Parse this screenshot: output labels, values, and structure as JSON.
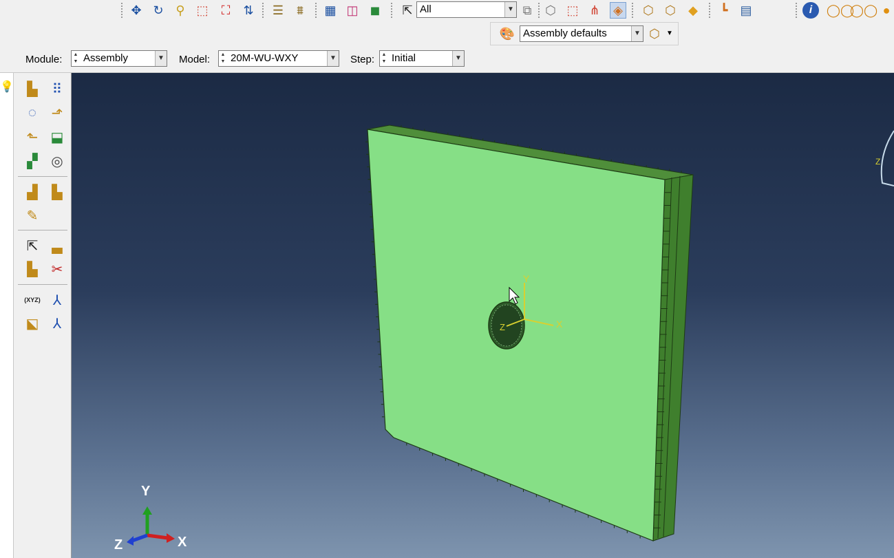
{
  "toolbar": {
    "selection_filter": "All",
    "display_group": "Assembly defaults",
    "icons": [
      "pan-icon",
      "rotate-icon",
      "magnify-icon",
      "zoom-box-icon",
      "auto-fit-icon",
      "cycle-views-icon",
      "iso-view-icon",
      "front-view-icon",
      "wireframe-icon",
      "hidden-line-icon",
      "shaded-icon",
      "select-arrow-icon",
      "selection-options-icon",
      "box-select-icon",
      "drag-select-icon",
      "cut-view-icon",
      "perspective-icon",
      "view-front-icon",
      "view-side-icon",
      "view-top-icon",
      "query-icon",
      "table-icon",
      "info-icon",
      "boolean-union-icon",
      "boolean-intersect-icon",
      "boolean-subtract-icon"
    ]
  },
  "context_bar": {
    "module_label": "Module:",
    "module_value": "Assembly",
    "model_label": "Model:",
    "model_value": "20M-WU-WXY",
    "step_label": "Step:",
    "step_value": "Initial"
  },
  "toolbox": {
    "icons": [
      "create-instance-icon",
      "linear-pattern-icon",
      "radial-pattern-icon",
      "translate-instance-icon",
      "rotate-instance-icon",
      "translate-to-icon",
      "merge-cut-icon",
      "boolean-instances-icon",
      "constraint-parallel-face-icon",
      "constraint-face-to-face-icon",
      "constraint-edit-icon",
      "query-select-icon",
      "datum-icon",
      "feature-manager-icon",
      "feature-delete-icon",
      "datum-point-icon",
      "datum-axis-icon",
      "datum-plane-icon",
      "datum-csys-icon"
    ]
  },
  "viewport": {
    "csys_labels": {
      "x": "X",
      "y": "Y",
      "z": "Z"
    },
    "triad_labels": {
      "x": "X",
      "y": "Y",
      "z": "Z"
    },
    "edge_triad_label": "Z",
    "colors": {
      "part_face": "#86df86",
      "part_side": "#3f7f2d",
      "part_edge": "#1d3a14",
      "csys": "#d8d030",
      "triad_x": "#d02020",
      "triad_y": "#20a020",
      "triad_z": "#2040d0"
    }
  }
}
